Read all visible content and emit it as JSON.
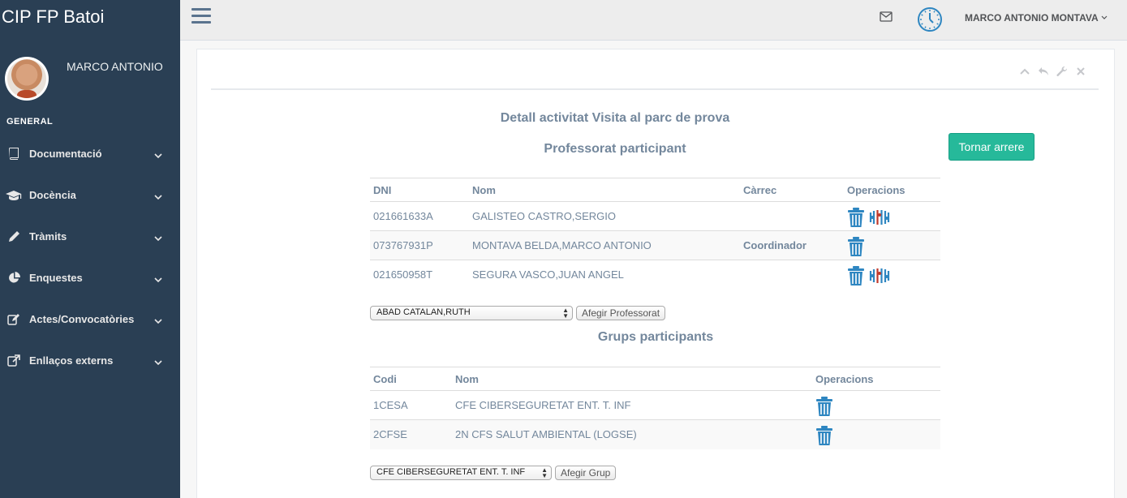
{
  "brand": "CIP FP Batoi",
  "profile": {
    "name": "MARCO ANTONIO"
  },
  "sidebar": {
    "section": "GENERAL",
    "items": [
      {
        "label": "Documentació",
        "icon": "book-icon"
      },
      {
        "label": "Docència",
        "icon": "graduation-cap-icon"
      },
      {
        "label": "Tràmits",
        "icon": "pencil-icon"
      },
      {
        "label": "Enquestes",
        "icon": "pie-chart-icon"
      },
      {
        "label": "Actes/Convocatòries",
        "icon": "edit-icon"
      },
      {
        "label": "Enllaços externs",
        "icon": "external-link-icon"
      }
    ]
  },
  "topbar": {
    "user": "MARCO ANTONIO MONTAVA"
  },
  "main": {
    "title": "Detall activitat Visita al parc de prova",
    "section_professors": "Professorat participant",
    "back_button": "Tornar arrere",
    "professors": {
      "headers": [
        "DNI",
        "Nom",
        "Càrrec",
        "Operacions"
      ],
      "rows": [
        {
          "dni": "021661633A",
          "nom": "GALISTEO CASTRO,SERGIO",
          "carrec": ""
        },
        {
          "dni": "073767931P",
          "nom": "MONTAVA BELDA,MARCO ANTONIO",
          "carrec": "Coordinador"
        },
        {
          "dni": "021650958T",
          "nom": "SEGURA VASCO,JUAN ANGEL",
          "carrec": ""
        }
      ]
    },
    "professor_select": {
      "value": "ABAD CATALAN,RUTH"
    },
    "add_professor_button": "Afegir Professorat",
    "section_groups": "Grups participants",
    "groups": {
      "headers": [
        "Codi",
        "Nom",
        "Operacions"
      ],
      "rows": [
        {
          "codi": "1CESA",
          "nom": "CFE CIBERSEGURETAT ENT. T. INF"
        },
        {
          "codi": "2CFSE",
          "nom": "2N CFS SALUT AMBIENTAL (LOGSE)"
        }
      ]
    },
    "group_select": {
      "value": "CFE CIBERSEGURETAT ENT. T. INF"
    },
    "add_group_button": "Afegir Grup"
  },
  "colors": {
    "sidebar": "#2a3f54",
    "accent": "#26b99a",
    "text": "#73879c",
    "icon_blue": "#2e86c1"
  }
}
